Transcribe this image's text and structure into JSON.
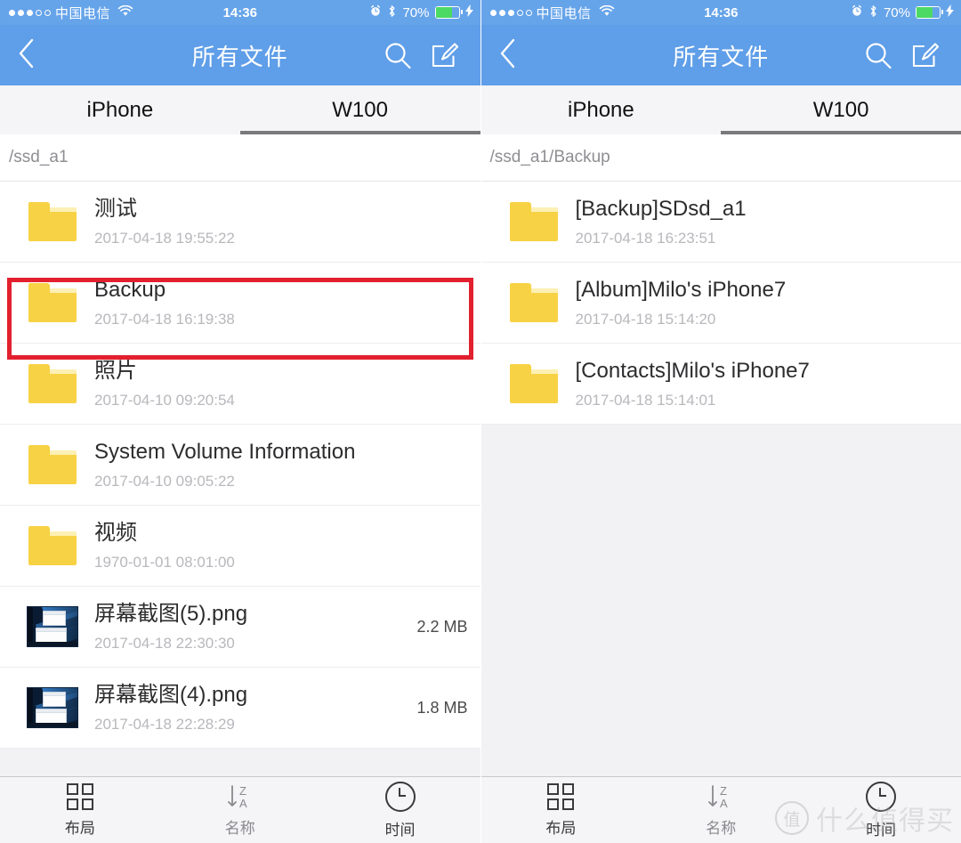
{
  "statusbar": {
    "carrier": "中国电信",
    "signal_filled": 3,
    "signal_total": 5,
    "wifi_icon": "wifi-icon",
    "time": "14:36",
    "alarm_icon": "alarm-icon",
    "bluetooth_icon": "bluetooth-icon",
    "battery_percent": "70%",
    "battery_level": 70,
    "charging_icon": "lightning-bolt-icon"
  },
  "navbar": {
    "back_icon": "chevron-left-icon",
    "title": "所有文件",
    "search_icon": "search-icon",
    "compose_icon": "compose-icon",
    "bg_color": "#5f9ee8"
  },
  "tabs": {
    "items": [
      {
        "label": "iPhone",
        "active": false
      },
      {
        "label": "W100",
        "active": true
      }
    ]
  },
  "toolbar": {
    "items": [
      {
        "label": "布局",
        "icon": "grid-layout-icon",
        "dim": false
      },
      {
        "label": "名称",
        "icon": "sort-az-icon",
        "dim": true
      },
      {
        "label": "时间",
        "icon": "clock-icon",
        "dim": false
      }
    ]
  },
  "watermark": {
    "badge": "值",
    "text": "什么值得买"
  },
  "left_panel": {
    "path": "/ssd_a1",
    "highlighted_row_index": 1,
    "highlight_color": "#e2202e",
    "rows": [
      {
        "icon": "folder-icon",
        "name": "测试",
        "date": "2017-04-18 19:55:22",
        "size": ""
      },
      {
        "icon": "folder-icon",
        "name": "Backup",
        "date": "2017-04-18 16:19:38",
        "size": ""
      },
      {
        "icon": "folder-icon",
        "name": "照片",
        "date": "2017-04-10 09:20:54",
        "size": ""
      },
      {
        "icon": "folder-icon",
        "name": "System Volume Information",
        "date": "2017-04-10 09:05:22",
        "size": ""
      },
      {
        "icon": "folder-icon",
        "name": "视频",
        "date": "1970-01-01 08:01:00",
        "size": ""
      },
      {
        "icon": "image-thumbnail-icon",
        "name": "屏幕截图(5).png",
        "date": "2017-04-18 22:30:30",
        "size": "2.2 MB"
      },
      {
        "icon": "image-thumbnail-icon",
        "name": "屏幕截图(4).png",
        "date": "2017-04-18 22:28:29",
        "size": "1.8 MB"
      }
    ]
  },
  "right_panel": {
    "path": "/ssd_a1/Backup",
    "rows": [
      {
        "icon": "folder-icon",
        "name": "[Backup]SDsd_a1",
        "date": "2017-04-18 16:23:51",
        "size": ""
      },
      {
        "icon": "folder-icon",
        "name": "[Album]Milo's iPhone7",
        "date": "2017-04-18 15:14:20",
        "size": ""
      },
      {
        "icon": "folder-icon",
        "name": "[Contacts]Milo's iPhone7",
        "date": "2017-04-18 15:14:01",
        "size": ""
      }
    ]
  }
}
